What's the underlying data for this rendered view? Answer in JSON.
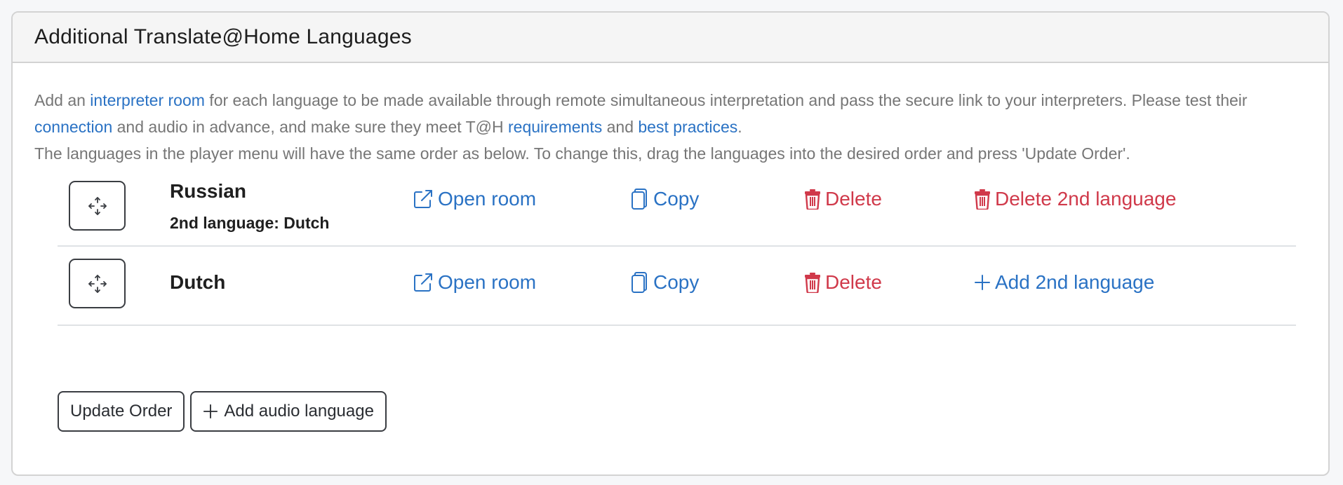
{
  "panel": {
    "title": "Additional Translate@Home Languages"
  },
  "intro": {
    "line1_pre": "Add an ",
    "link_interpreter_room": "interpreter room",
    "line1_post": " for each language to be made available through remote simultaneous interpretation and pass the secure link to your interpreters. Please test their ",
    "link_connection": "connection",
    "line2_mid": " and audio in advance, and make sure they meet T@H ",
    "link_requirements": "requirements",
    "line2_and": " and ",
    "link_best_practices": "best practices",
    "line2_end": ".",
    "line3": "The languages in the player menu will have the same order as below. To change this, drag the languages into the desired order and press 'Update Order'."
  },
  "languages": [
    {
      "name": "Russian",
      "second_language": "2nd language: Dutch",
      "open_room": "Open room",
      "copy": "Copy",
      "delete": "Delete",
      "second_action": "Delete 2nd language"
    },
    {
      "name": "Dutch",
      "open_room": "Open room",
      "copy": "Copy",
      "delete": "Delete",
      "second_action": "Add 2nd language"
    }
  ],
  "buttons": {
    "update_order": "Update Order",
    "add_audio_language": "Add audio language"
  },
  "colors": {
    "link": "#2a72c4",
    "danger": "#d0394a",
    "text_muted": "#767676"
  },
  "icons": {
    "drag": "move-arrows-icon",
    "open": "external-link-icon",
    "copy": "copy-icon",
    "delete": "trash-icon",
    "add": "plus-icon"
  }
}
